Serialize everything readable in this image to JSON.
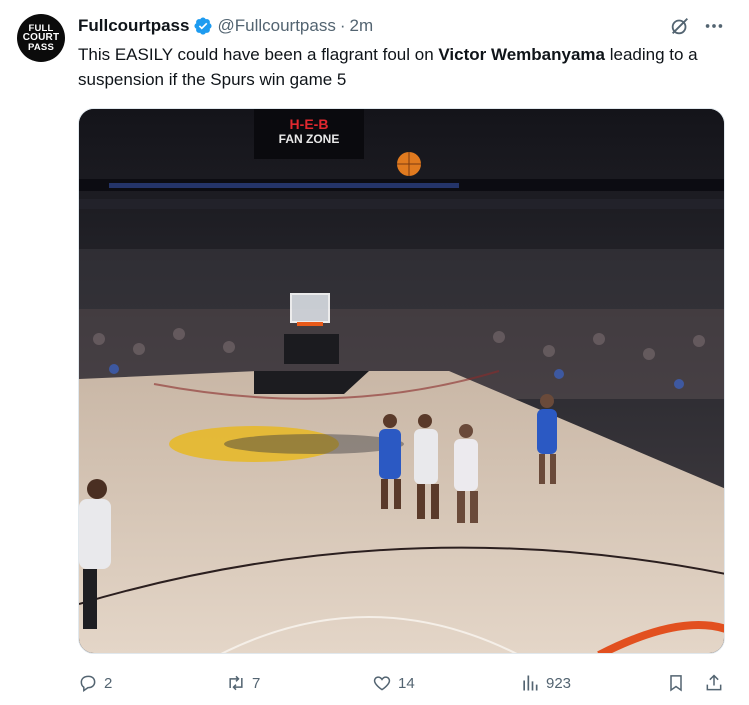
{
  "tweet": {
    "avatar_text": [
      "FULL",
      "COURT",
      "PASS"
    ],
    "display_name": "Fullcourtpass",
    "handle": "@Fullcourtpass",
    "separator": "·",
    "time": "2m",
    "text_before": "This EASILY could have been a flagrant foul on ",
    "text_bold": "Victor Wembanyama",
    "text_after": " leading to a suspension if the Spurs win game 5"
  },
  "media": {
    "scoreboard_text": "H-E-B",
    "fan_zone_text": "FAN ZONE"
  },
  "actions": {
    "replies": "2",
    "reposts": "7",
    "likes": "14",
    "views": "923"
  },
  "colors": {
    "accent": "#1d9bf0",
    "muted": "#536471",
    "text": "#0f1419"
  }
}
